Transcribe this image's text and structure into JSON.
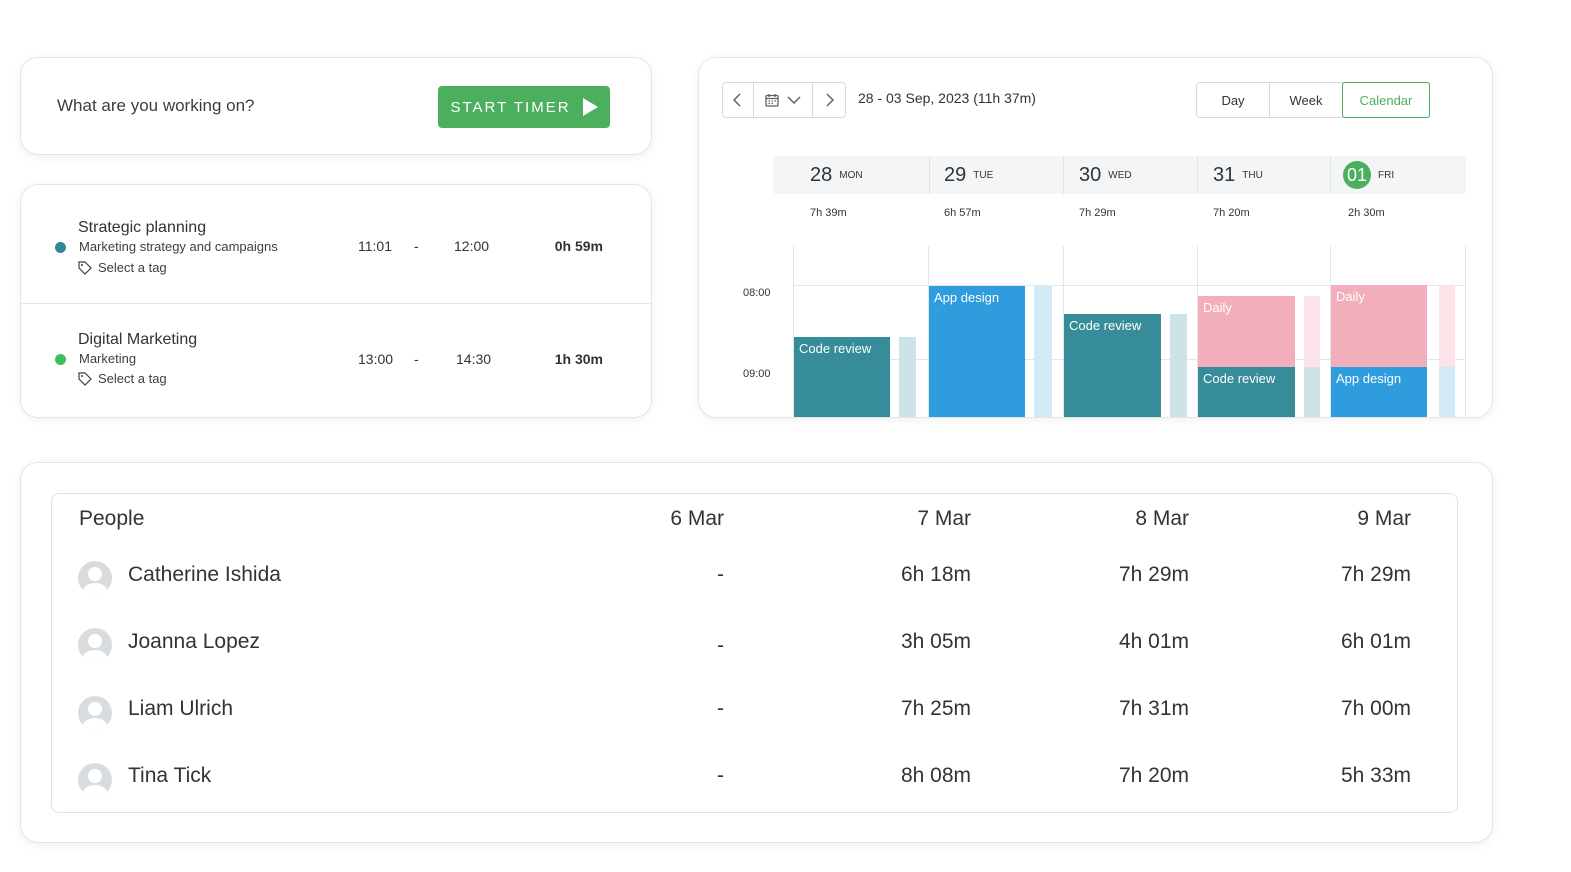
{
  "timer": {
    "prompt": "What are you working on?",
    "start_label": "START TIMER"
  },
  "entries": [
    {
      "title": "Strategic planning",
      "subtitle": "Marketing strategy and campaigns",
      "tag": "Select a tag",
      "start": "11:01",
      "dash": "-",
      "end": "12:00",
      "duration": "0h 59m",
      "dot_color": "#2e8a99"
    },
    {
      "title": "Digital Marketing",
      "subtitle": "Marketing",
      "tag": "Select a tag",
      "start": "13:00",
      "dash": "-",
      "end": "14:30",
      "duration": "1h 30m",
      "dot_color": "#3fbf5c"
    }
  ],
  "calendar": {
    "range": "28 - 03 Sep, 2023 (11h 37m)",
    "views": [
      "Day",
      "Week",
      "Calendar"
    ],
    "active_view": "Calendar",
    "days": [
      {
        "num": "28",
        "dow": "MON",
        "total": "7h 39m",
        "today": false
      },
      {
        "num": "29",
        "dow": "TUE",
        "total": "6h 57m",
        "today": false
      },
      {
        "num": "30",
        "dow": "WED",
        "total": "7h 29m",
        "today": false
      },
      {
        "num": "31",
        "dow": "THU",
        "total": "7h 20m",
        "today": false
      },
      {
        "num": "01",
        "dow": "FRI",
        "total": "2h 30m",
        "today": true
      }
    ],
    "times": [
      "08:00",
      "09:00"
    ],
    "events": [
      {
        "label": "Code review",
        "day": 0,
        "color": "#378c99"
      },
      {
        "label": "App design",
        "day": 1,
        "color": "#2f9cde"
      },
      {
        "label": "Code review",
        "day": 2,
        "color": "#378c99"
      },
      {
        "label": "Daily",
        "day": 3,
        "color": "#f2aebb"
      },
      {
        "label": "Code review",
        "day": 3,
        "color": "#378c99"
      },
      {
        "label": "Daily",
        "day": 4,
        "color": "#f2aebb"
      },
      {
        "label": "App design",
        "day": 4,
        "color": "#2f9cde"
      }
    ]
  },
  "people": {
    "header": "People",
    "dates": [
      "6 Mar",
      "7 Mar",
      "8 Mar",
      "9 Mar"
    ],
    "rows": [
      {
        "name": "Catherine Ishida",
        "values": [
          "-",
          "6h 18m",
          "7h 29m",
          "7h 29m"
        ]
      },
      {
        "name": "Joanna Lopez",
        "values": [
          "-",
          "3h 05m",
          "4h 01m",
          "6h 01m"
        ]
      },
      {
        "name": "Liam Ulrich",
        "values": [
          "-",
          "7h 25m",
          "7h 31m",
          "7h 00m"
        ]
      },
      {
        "name": "Tina Tick",
        "values": [
          "-",
          "8h 08m",
          "7h 20m",
          "5h 33m"
        ]
      }
    ]
  }
}
